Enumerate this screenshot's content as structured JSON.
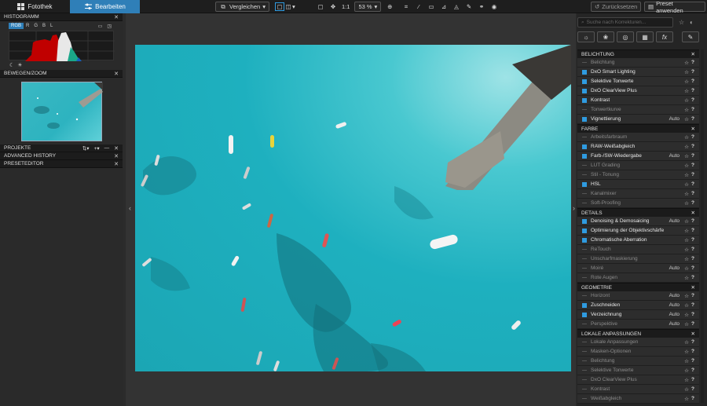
{
  "topbar": {
    "tab_photo": "Fotothek",
    "tab_edit": "Bearbeiten",
    "compare": "Vergleichen",
    "one_to_one": "1:1",
    "zoom": "53 %",
    "reset": "Zurücksetzen",
    "apply_preset": "Preset anwenden"
  },
  "left": {
    "histogram_title": "HISTOGRAMM",
    "hist_tabs": [
      "RGB",
      "R",
      "G",
      "B",
      "L"
    ],
    "move_zoom_title": "BEWEGEN/ZOOM",
    "projects_title": "PROJEKTE",
    "history_title": "ADVANCED HISTORY",
    "preset_title": "PRESETEDITOR"
  },
  "right": {
    "search_placeholder": "Suche nach Korrekturen...",
    "sections": [
      {
        "title": "BELICHTUNG",
        "rows": [
          {
            "label": "Belichtung",
            "on": false,
            "auto": ""
          },
          {
            "label": "DxO Smart Lighting",
            "on": true,
            "auto": ""
          },
          {
            "label": "Selektive Tonwerte",
            "on": true,
            "auto": ""
          },
          {
            "label": "DxO ClearView Plus",
            "on": true,
            "auto": ""
          },
          {
            "label": "Kontrast",
            "on": true,
            "auto": ""
          },
          {
            "label": "Tonwertkurve",
            "on": false,
            "auto": ""
          },
          {
            "label": "Vignettierung",
            "on": true,
            "auto": "Auto"
          }
        ]
      },
      {
        "title": "FARBE",
        "rows": [
          {
            "label": "Arbeitsfarbraum",
            "on": false,
            "auto": ""
          },
          {
            "label": "RAW-Weißabgleich",
            "on": true,
            "auto": ""
          },
          {
            "label": "Farb-/SW-Wiedergabe",
            "on": true,
            "auto": "Auto"
          },
          {
            "label": "LUT Grading",
            "on": false,
            "auto": ""
          },
          {
            "label": "Stil - Tonung",
            "on": false,
            "auto": ""
          },
          {
            "label": "HSL",
            "on": true,
            "auto": ""
          },
          {
            "label": "Kanalmixer",
            "on": false,
            "auto": ""
          },
          {
            "label": "Soft-Proofing",
            "on": false,
            "auto": ""
          }
        ]
      },
      {
        "title": "DETAILS",
        "rows": [
          {
            "label": "Denoising & Demosaicing",
            "on": true,
            "auto": "Auto"
          },
          {
            "label": "Optimierung der Objektivschärfe",
            "on": true,
            "auto": ""
          },
          {
            "label": "Chromatische Aberration",
            "on": true,
            "auto": ""
          },
          {
            "label": "ReTouch",
            "on": false,
            "auto": ""
          },
          {
            "label": "Unscharfmaskierung",
            "on": false,
            "auto": ""
          },
          {
            "label": "Moiré",
            "on": false,
            "auto": "Auto"
          },
          {
            "label": "Rote Augen",
            "on": false,
            "auto": ""
          }
        ]
      },
      {
        "title": "GEOMETRIE",
        "rows": [
          {
            "label": "Horizont",
            "on": false,
            "auto": "Auto"
          },
          {
            "label": "Zuschneiden",
            "on": true,
            "auto": "Auto"
          },
          {
            "label": "Verzeichnung",
            "on": true,
            "auto": "Auto"
          },
          {
            "label": "Perspektive",
            "on": false,
            "auto": "Auto"
          }
        ]
      },
      {
        "title": "LOKALE ANPASSUNGEN",
        "rows": [
          {
            "label": "Lokale Anpassungen",
            "on": false,
            "auto": ""
          },
          {
            "label": "Masken-Optionen",
            "on": false,
            "auto": ""
          },
          {
            "label": "Belichtung",
            "on": false,
            "auto": ""
          },
          {
            "label": "Selektive Tonwerte",
            "on": false,
            "auto": ""
          },
          {
            "label": "DxO ClearView Plus",
            "on": false,
            "auto": ""
          },
          {
            "label": "Kontrast",
            "on": false,
            "auto": ""
          },
          {
            "label": "Weißabgleich",
            "on": false,
            "auto": ""
          }
        ]
      }
    ]
  }
}
